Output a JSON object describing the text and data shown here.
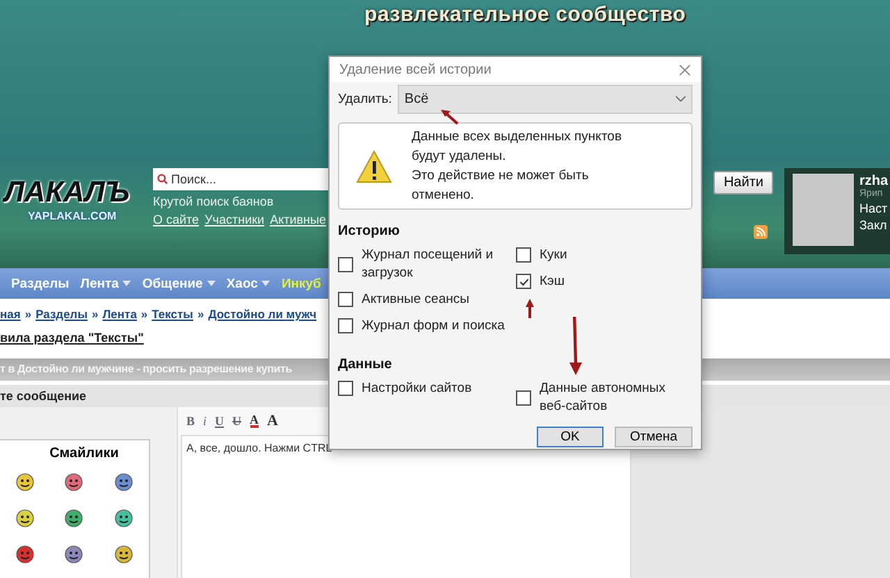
{
  "banner": {
    "tagline": "развлекательное сообщество",
    "logo": "ЛАКАЛЪ",
    "logo_sub": "YAPLAKAL.COM"
  },
  "search": {
    "placeholder": "Поиск...",
    "button": "Найти",
    "hint": "Крутой поиск баянов",
    "links": [
      "О сайте",
      "Участники",
      "Активные"
    ]
  },
  "user": {
    "name": "rzha",
    "rank": "Ярип",
    "links": [
      "Наст",
      "Закл"
    ]
  },
  "nav": [
    {
      "label": "Разделы",
      "dropdown": false,
      "highlight": false
    },
    {
      "label": "Лента",
      "dropdown": true,
      "highlight": false
    },
    {
      "label": "Общение",
      "dropdown": true,
      "highlight": false
    },
    {
      "label": "Хаос",
      "dropdown": true,
      "highlight": false
    },
    {
      "label": "Инкуб",
      "dropdown": false,
      "highlight": true
    }
  ],
  "breadcrumbs": [
    "ная",
    "Разделы",
    "Лента",
    "Тексты",
    "Достойно ли мужч"
  ],
  "breadcrumb_separator": "»",
  "rules_link": "вила раздела \"Тексты\"",
  "topic_bar": "т в Достойно ли мужчине - просить разрешение купить",
  "reply_header": "те сообщение",
  "smileys": {
    "title": "Смайлики"
  },
  "editor": {
    "toolbar": [
      {
        "kind": "bold",
        "label": "B"
      },
      {
        "kind": "italic",
        "label": "i"
      },
      {
        "kind": "underline",
        "label": "U"
      },
      {
        "kind": "strike",
        "label": "U"
      },
      {
        "kind": "color",
        "label": "A"
      },
      {
        "kind": "size",
        "label": "A"
      }
    ],
    "value": "А, все, дошло. Нажми CTRL"
  },
  "dialog": {
    "title": "Удаление всей истории",
    "range_label": "Удалить:",
    "range_value": "Всё",
    "warning": [
      "Данные всех выделенных пунктов будут удалены.",
      "Это действие не может быть отменено."
    ],
    "sections": [
      {
        "title": "Историю",
        "columns": [
          [
            {
              "label": "Журнал посещений и загрузок",
              "checked": false
            },
            {
              "label": "Активные сеансы",
              "checked": false
            },
            {
              "label": "Журнал форм и поиска",
              "checked": false
            }
          ],
          [
            {
              "label": "Куки",
              "checked": false
            },
            {
              "label": "Кэш",
              "checked": true
            }
          ]
        ]
      },
      {
        "title": "Данные",
        "columns": [
          [
            {
              "label": "Настройки сайтов",
              "checked": false
            }
          ],
          [
            {
              "label": "Данные автономных веб-сайтов",
              "checked": false
            }
          ]
        ]
      }
    ],
    "buttons": [
      {
        "label": "OK",
        "default": true
      },
      {
        "label": "Отмена",
        "default": false
      }
    ]
  }
}
